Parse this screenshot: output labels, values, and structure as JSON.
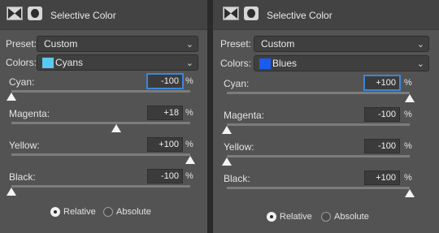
{
  "panels": [
    {
      "title": "Selective Color",
      "preset_label": "Preset:",
      "preset_value": "Custom",
      "colors_label": "Colors:",
      "colors_value": "Cyans",
      "colors_swatch": "#5ac8f5",
      "sliders": [
        {
          "label": "Cyan:",
          "value": "-100",
          "fraction": 0.0,
          "focused": true
        },
        {
          "label": "Magenta:",
          "value": "+18",
          "fraction": 0.59,
          "focused": false
        },
        {
          "label": "Yellow:",
          "value": "+100",
          "fraction": 1.0,
          "focused": false
        },
        {
          "label": "Black:",
          "value": "-100",
          "fraction": 0.0,
          "focused": false
        }
      ],
      "pct_symbol": "%",
      "radio_relative": "Relative",
      "radio_absolute": "Absolute",
      "selected_mode": "Relative"
    },
    {
      "title": "Selective Color",
      "preset_label": "Preset:",
      "preset_value": "Custom",
      "colors_label": "Colors:",
      "colors_value": "Blues",
      "colors_swatch": "#1a5cf0",
      "sliders": [
        {
          "label": "Cyan:",
          "value": "+100",
          "fraction": 1.0,
          "focused": true
        },
        {
          "label": "Magenta:",
          "value": "-100",
          "fraction": 0.0,
          "focused": false
        },
        {
          "label": "Yellow:",
          "value": "-100",
          "fraction": 0.0,
          "focused": false
        },
        {
          "label": "Black:",
          "value": "+100",
          "fraction": 1.0,
          "focused": false
        }
      ],
      "pct_symbol": "%",
      "radio_relative": "Relative",
      "radio_absolute": "Absolute",
      "selected_mode": "Relative"
    }
  ]
}
